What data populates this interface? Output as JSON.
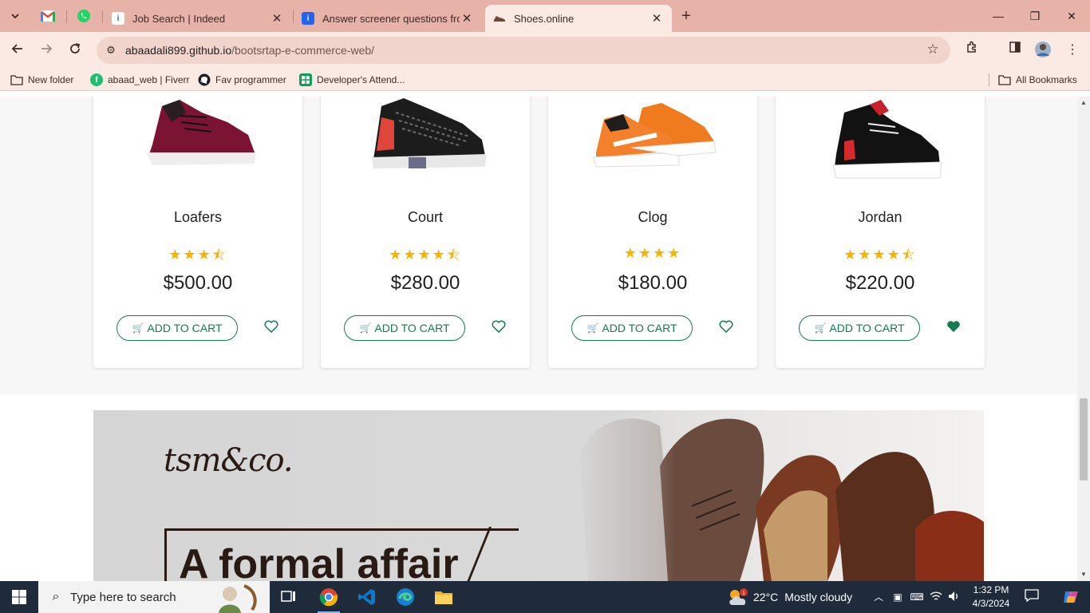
{
  "browser": {
    "tabs": [
      {
        "title": "",
        "favicon": "gmail-icon"
      },
      {
        "title": "",
        "favicon": "whatsapp-icon"
      },
      {
        "title": "Job Search | Indeed",
        "favicon": "indeed-icon"
      },
      {
        "title": "Answer screener questions from",
        "favicon": "indeed-icon"
      },
      {
        "title": "Shoes.online",
        "favicon": "shoe-icon",
        "active": true
      }
    ],
    "url_host": "abaadali899.github.io",
    "url_path": "/bootsrtap-e-commerce-web/",
    "bookmarks": [
      {
        "label": "New folder",
        "icon": "folder-icon"
      },
      {
        "label": "abaad_web | Fiverr",
        "icon": "fiverr-icon"
      },
      {
        "label": "Fav programmer",
        "icon": "github-icon"
      },
      {
        "label": "Developer's Attend...",
        "icon": "sheets-icon"
      }
    ],
    "all_bookmarks_label": "All Bookmarks"
  },
  "products": [
    {
      "name": "Loafers",
      "rating": 3.5,
      "stars_text": "★★★⯪",
      "price": "$500.00",
      "favorited": false
    },
    {
      "name": "Court",
      "rating": 4.5,
      "stars_text": "★★★★⯪",
      "price": "$280.00",
      "favorited": false
    },
    {
      "name": "Clog",
      "rating": 4,
      "stars_text": "★★★★",
      "price": "$180.00",
      "favorited": false
    },
    {
      "name": "Jordan",
      "rating": 4.5,
      "stars_text": "★★★★⯪",
      "price": "$220.00",
      "favorited": true
    }
  ],
  "add_to_cart_label": "ADD TO CART",
  "banner": {
    "logo": "tsm&co.",
    "headline": "A formal affair"
  },
  "colors": {
    "accent": "#137b4e",
    "star": "#f5b400",
    "chrome": "#e7b3a8"
  },
  "taskbar": {
    "search_placeholder": "Type here to search",
    "weather_temp": "22°C",
    "weather_desc": "Mostly cloudy",
    "weather_badge": "1",
    "time": "1:32 PM",
    "date": "4/3/2024"
  }
}
